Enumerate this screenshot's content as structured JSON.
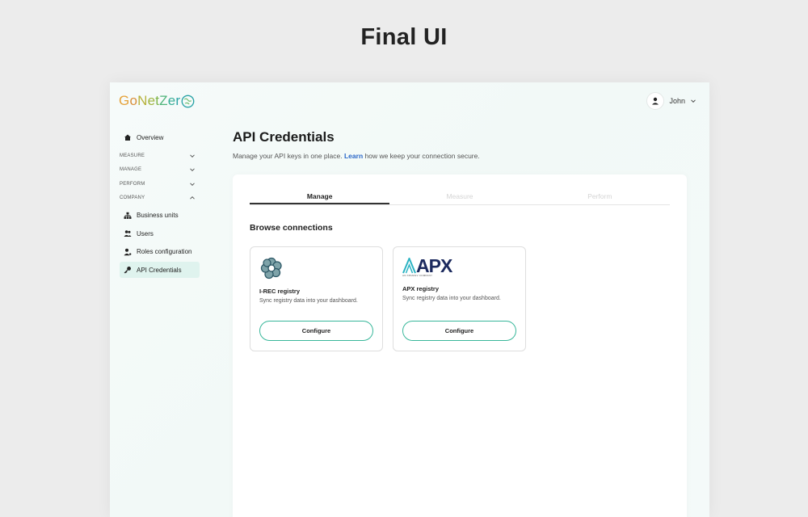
{
  "heading": "Final UI",
  "brand": {
    "letters": [
      "G",
      "o",
      "N",
      "e",
      "t",
      "Z",
      "e",
      "r"
    ],
    "colors": [
      "#e5a23a",
      "#d98f3a",
      "#b7b23c",
      "#9fb43f",
      "#7fb549",
      "#4fb47a",
      "#37ad96",
      "#2aa3a6"
    ],
    "accent": "#38b79a"
  },
  "user": {
    "name": "John"
  },
  "sidebar": {
    "overview": "Overview",
    "sections": [
      {
        "label": "MEASURE",
        "expanded": false
      },
      {
        "label": "MANAGE",
        "expanded": false
      },
      {
        "label": "PERFORM",
        "expanded": false
      },
      {
        "label": "COMPANY",
        "expanded": true
      }
    ],
    "company_items": [
      {
        "label": "Business units",
        "icon": "org-chart-icon",
        "active": false
      },
      {
        "label": "Users",
        "icon": "users-icon",
        "active": false
      },
      {
        "label": "Roles configuration",
        "icon": "user-settings-icon",
        "active": false
      },
      {
        "label": "API Credentials",
        "icon": "key-icon",
        "active": true
      }
    ]
  },
  "main": {
    "title": "API Credentials",
    "subtitle_before": "Manage your API keys in one place. ",
    "subtitle_link": "Learn",
    "subtitle_after": " how we keep your connection secure.",
    "tabs": [
      {
        "label": "Manage",
        "active": true
      },
      {
        "label": "Measure",
        "active": false
      },
      {
        "label": "Perform",
        "active": false
      }
    ],
    "browse_title": "Browse connections",
    "connections": [
      {
        "name": "I-REC registry",
        "description": "Sync registry data into your dashboard.",
        "button": "Configure"
      },
      {
        "name": "APX registry",
        "description": "Sync registry data into your dashboard.",
        "button": "Configure",
        "logo_text": "APX",
        "logo_subtext": "AN XPANSIV COMPANY"
      }
    ]
  }
}
